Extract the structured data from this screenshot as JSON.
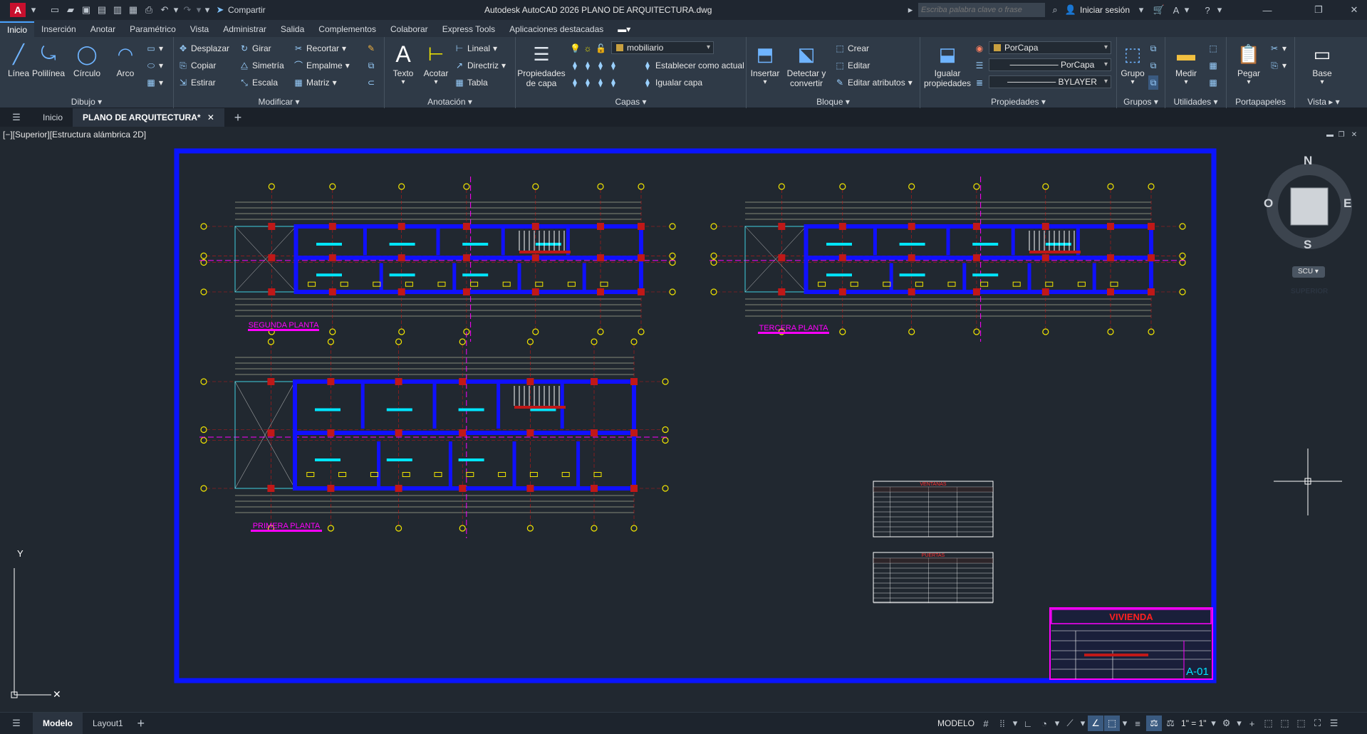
{
  "titlebar": {
    "app_badge": "A",
    "share_label": "Compartir",
    "title": "Autodesk AutoCAD 2026   PLANO DE ARQUITECTURA.dwg",
    "search_placeholder": "Escriba palabra clave o frase",
    "signin_label": "Iniciar sesión"
  },
  "ribbon_tabs": [
    "Inicio",
    "Inserción",
    "Anotar",
    "Paramétrico",
    "Vista",
    "Administrar",
    "Salida",
    "Complementos",
    "Colaborar",
    "Express Tools",
    "Aplicaciones destacadas"
  ],
  "ribbon": {
    "draw": {
      "title": "Dibujo",
      "line": "Línea",
      "polyline": "Polilínea",
      "circle": "Círculo",
      "arc": "Arco"
    },
    "modify": {
      "title": "Modificar",
      "move": "Desplazar",
      "rotate": "Girar",
      "trim": "Recortar",
      "copy": "Copiar",
      "mirror": "Simetría",
      "fillet": "Empalme",
      "stretch": "Estirar",
      "scale": "Escala",
      "array": "Matriz"
    },
    "annotation": {
      "title": "Anotación",
      "text": "Texto",
      "dimension": "Acotar",
      "linear": "Lineal",
      "leader": "Directriz",
      "table": "Tabla"
    },
    "layers": {
      "title": "Capas",
      "props_line1": "Propiedades",
      "props_line2": "de capa",
      "current_layer": "mobiliario",
      "set_current": "Establecer como actual",
      "match_layer": "Igualar capa"
    },
    "block": {
      "title": "Bloque",
      "insert": "Insertar",
      "detect_line1": "Detectar y",
      "detect_line2": "convertir",
      "create": "Crear",
      "edit": "Editar",
      "edit_attributes": "Editar atributos"
    },
    "properties": {
      "title": "Propiedades",
      "match_line1": "Igualar",
      "match_line2": "propiedades",
      "color": "PorCapa",
      "linetype": "PorCapa",
      "lineweight": "BYLAYER"
    },
    "groups": {
      "title": "Grupos",
      "group": "Grupo"
    },
    "utilities": {
      "title": "Utilidades",
      "measure": "Medir"
    },
    "clipboard": {
      "title": "Portapapeles",
      "paste": "Pegar"
    },
    "view": {
      "title": "Vista",
      "base": "Base"
    }
  },
  "file_tabs": {
    "start": "Inicio",
    "drawing": "PLANO DE ARQUITECTURA*"
  },
  "viewport": {
    "label": "[−][Superior][Estructura alámbrica 2D]",
    "viewcube": {
      "top": "SUPERIOR",
      "n": "N",
      "s": "S",
      "e": "E",
      "w": "O",
      "ucs": "SCU"
    },
    "ucs_y": "Y"
  },
  "drawing": {
    "plan2": "SEGUNDA PLANTA",
    "plan3": "TERCERA PLANTA",
    "plan1": "PRIMERA PLANTA",
    "windows_table": "VENTANAS",
    "doors_table": "PUERTAS",
    "title_block": "VIVIENDA",
    "sheet": "A-01"
  },
  "status": {
    "model_tab": "Modelo",
    "layout_tab": "Layout1",
    "model_label": "MODELO",
    "scale": "1\" = 1\""
  },
  "colors": {
    "accent": "#4aa3ff",
    "wall_blue": "#1010ff",
    "column_red": "#c01818",
    "border_blue": "#0a14ff",
    "magenta": "#ff00ff",
    "cyan": "#00e5ff",
    "yellow": "#f2e600"
  }
}
